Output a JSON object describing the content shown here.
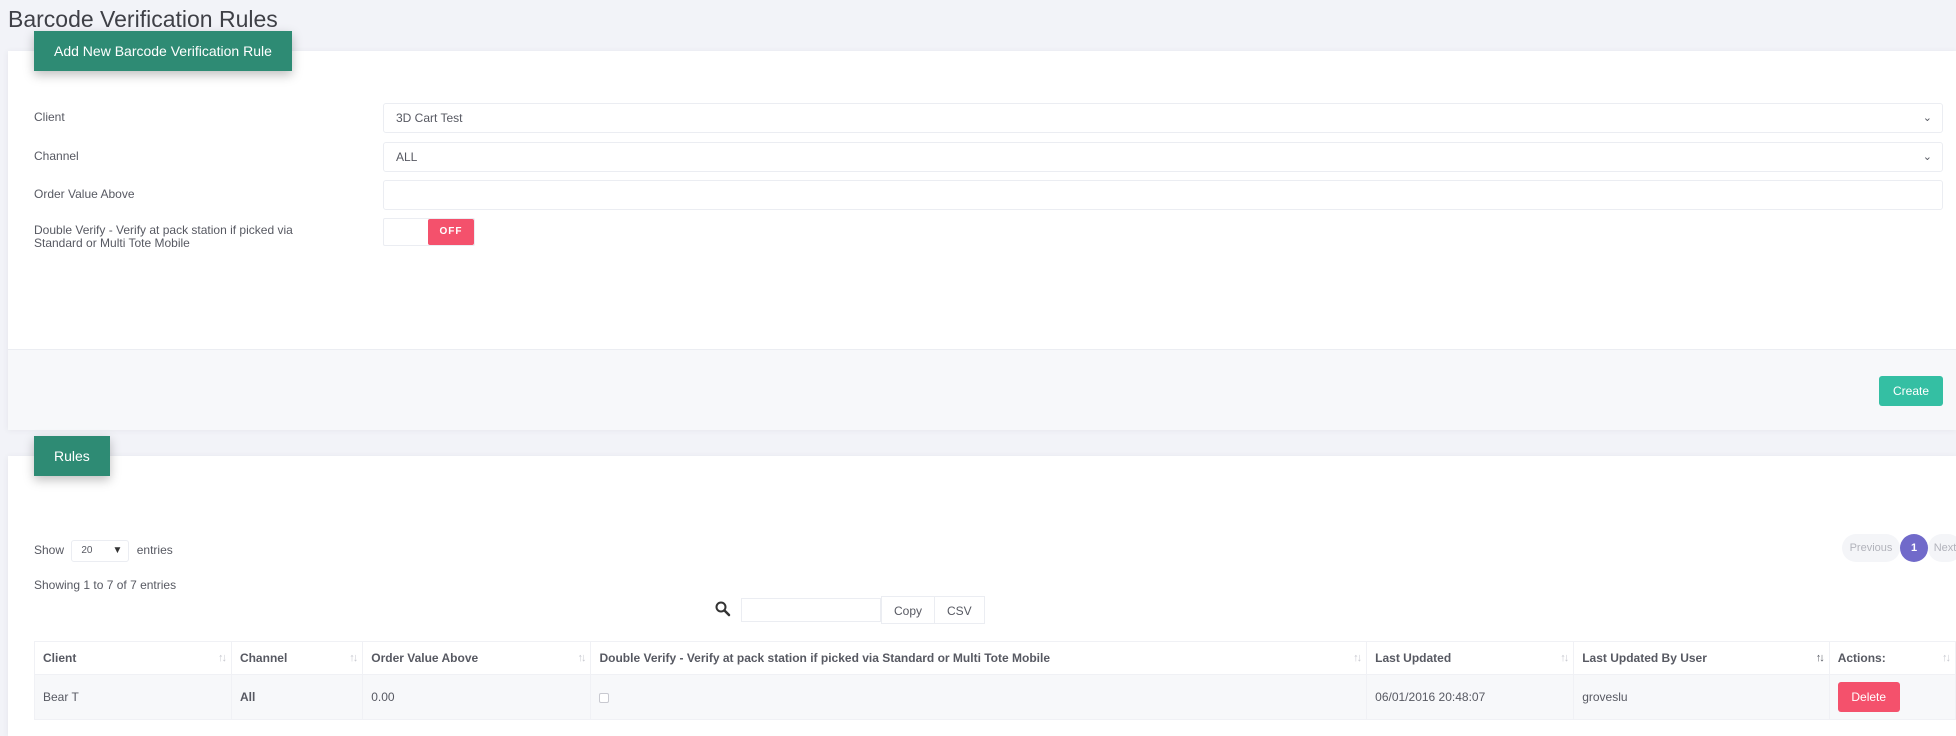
{
  "page_title": "Barcode Verification Rules",
  "form": {
    "header": "Add New Barcode Verification Rule",
    "client_label": "Client",
    "client_value": "3D Cart Test",
    "channel_label": "Channel",
    "channel_value": "ALL",
    "order_value_label": "Order Value Above",
    "order_value_value": "",
    "double_verify_label": "Double Verify - Verify at pack station if picked via Standard or Multi Tote Mobile",
    "double_verify_state": "OFF",
    "create_label": "Create"
  },
  "rules": {
    "header": "Rules",
    "show_label": "Show",
    "page_length": "20",
    "entries_label": "entries",
    "info": "Showing 1 to 7 of 7 entries",
    "copy_label": "Copy",
    "csv_label": "CSV",
    "pagination": {
      "previous": "Previous",
      "current": "1",
      "next": "Next"
    },
    "columns": [
      "Client",
      "Channel",
      "Order Value Above",
      "Double Verify - Verify at pack station if picked via Standard or Multi Tote Mobile",
      "Last Updated",
      "Last Updated By User",
      "Actions:"
    ],
    "rows": [
      {
        "client": "Bear T",
        "channel": "All",
        "order_value": "0.00",
        "double_verify": false,
        "last_updated": "06/01/2016 20:48:07",
        "user": "groveslu",
        "action": "Delete"
      }
    ]
  },
  "colors": {
    "header_tab": "#2e8b74",
    "create": "#34bfa3",
    "danger": "#f4516c",
    "page_active": "#716aca"
  }
}
